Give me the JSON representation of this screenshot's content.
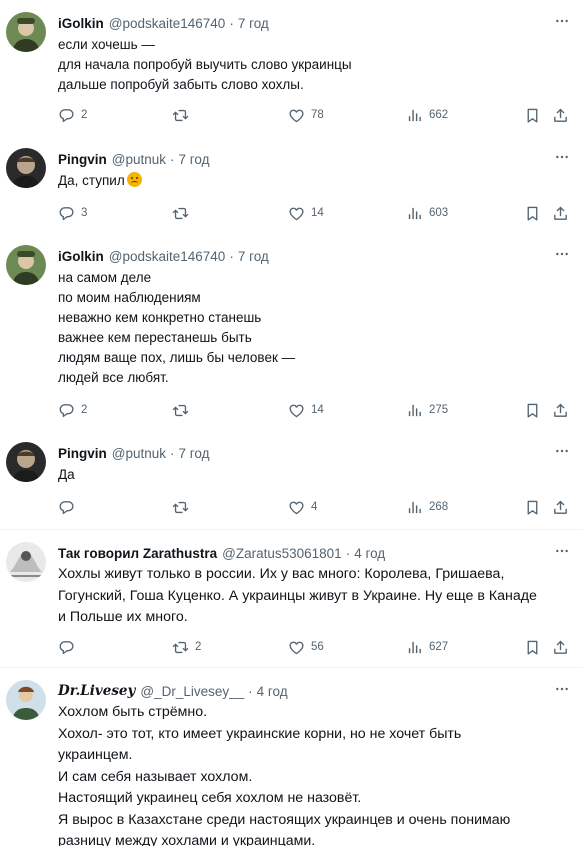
{
  "tweets": [
    {
      "name": "iGolkin",
      "handle": "@podskaite146740",
      "time": "7 год",
      "text": "если хочешь  —\nдля начала попробуй выучить слово украинцы\nдальше попробуй забыть слово хохлы.",
      "replies": "2",
      "retweets": "",
      "likes": "78",
      "views": "662"
    },
    {
      "name": "Pingvin",
      "handle": "@putnuk",
      "time": "7 год",
      "text": "Да, ступил",
      "emoji": "slightly-frowning-face-emoji",
      "replies": "3",
      "retweets": "",
      "likes": "14",
      "views": "603"
    },
    {
      "name": "iGolkin",
      "handle": "@podskaite146740",
      "time": "7 год",
      "text": "на самом деле\nпо моим наблюдениям\nневажно кем конкретно станешь\nважнее кем перестанешь быть\nлюдям ваще пох, лишь бы человек —\nлюдей все любят.",
      "replies": "2",
      "retweets": "",
      "likes": "14",
      "views": "275"
    },
    {
      "name": "Pingvin",
      "handle": "@putnuk",
      "time": "7 год",
      "text": "Да",
      "replies": "",
      "retweets": "",
      "likes": "4",
      "views": "268"
    },
    {
      "name": "Так говорил Zarathustra",
      "handle": "@Zaratus53061801",
      "time": "4 год",
      "text": "Хохлы живут только в россии. Их у вас много: Королева, Гришаева,\nГогунский, Гоша Куценко. А украинцы живут в Украине. Ну еще в Канаде\nи Польше их много.",
      "replies": "",
      "retweets": "2",
      "likes": "56",
      "views": "627"
    },
    {
      "name": "Dr.Livesey",
      "handle": "@_Dr_Livesey__",
      "time": "4 год",
      "text": "Хохлом быть стрёмно.\nХохол- это тот, кто имеет украинские корни, но не хочет быть\nукраинцем.\nИ сам себя называет хохлом.\nНастоящий украинец себя хохлом не назовёт.\nЯ вырос в Казахстане среди настоящих украинцев и очень понимаю\nразницу между хохлами и украинцами."
    }
  ],
  "icons": {
    "reply": "reply-icon",
    "retweet": "retweet-icon",
    "like": "heart-icon",
    "views": "views-icon",
    "bookmark": "bookmark-icon",
    "share": "share-icon",
    "more": "more-icon"
  },
  "colors": {
    "text": "#0f1419",
    "secondary": "#536471",
    "separator": "#eff3f4"
  }
}
